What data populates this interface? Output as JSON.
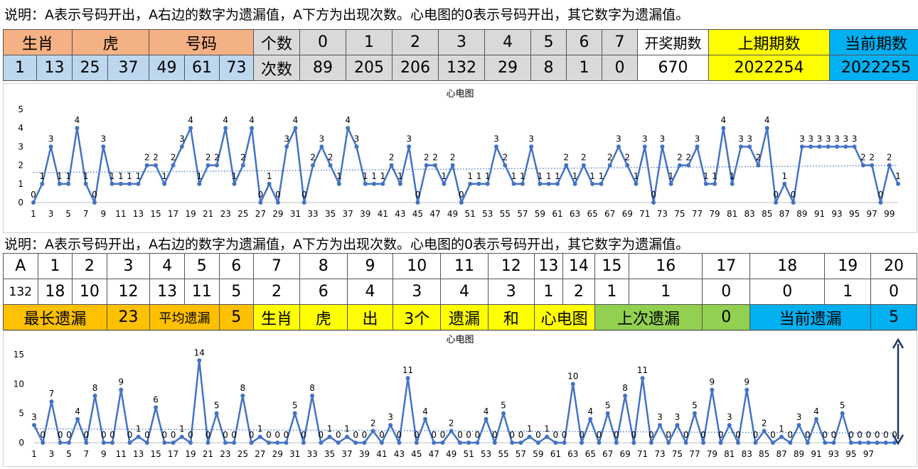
{
  "note": "说明：A表示号码开出，A右边的数字为遗漏值，A下方为出现次数。心电图的0表示号码开出，其它数字为遗漏值。",
  "table1": {
    "row1": [
      "生肖",
      "虎",
      "号码",
      "个数",
      "0",
      "1",
      "2",
      "3",
      "4",
      "5",
      "6",
      "7",
      "开奖期数",
      "上期期数",
      "当前期数"
    ],
    "row2": [
      "1",
      "13",
      "25",
      "37",
      "49",
      "61",
      "73",
      "次数",
      "89",
      "205",
      "206",
      "132",
      "29",
      "8",
      "1",
      "0",
      "670",
      "2022254",
      "2022255"
    ]
  },
  "table2": {
    "row1": [
      "A",
      "1",
      "2",
      "3",
      "4",
      "5",
      "6",
      "7",
      "8",
      "9",
      "10",
      "11",
      "12",
      "13",
      "14",
      "15",
      "16",
      "17",
      "18",
      "19",
      "20"
    ],
    "row2": [
      "132",
      "18",
      "10",
      "12",
      "13",
      "11",
      "5",
      "2",
      "6",
      "4",
      "3",
      "4",
      "3",
      "1",
      "2",
      "1",
      "1",
      "0",
      "0",
      "1",
      "0"
    ],
    "row3": [
      "最长遗漏",
      "23",
      "平均遗漏",
      "5",
      "生肖",
      "虎",
      "出",
      "3个",
      "遗漏",
      "和",
      "心电图",
      "上次遗漏",
      "0",
      "当前遗漏",
      "5"
    ]
  },
  "colors": {
    "line": "#4472c4",
    "salmon": "#f4b183",
    "blue": "#bdd7ee",
    "yellow": "#ffff00",
    "cyan": "#00b0f0",
    "orange": "#ffc000",
    "green": "#92d050",
    "arrow": "#1f3864"
  },
  "chart_data": [
    {
      "type": "line",
      "title": "心电图",
      "ylim": [
        0,
        5
      ],
      "yticks": [
        0,
        1,
        2,
        3,
        4,
        5
      ],
      "x_tick_labels": [
        "1",
        "3",
        "5",
        "7",
        "9",
        "11",
        "13",
        "15",
        "17",
        "19",
        "21",
        "23",
        "25",
        "27",
        "29",
        "31",
        "33",
        "35",
        "37",
        "39",
        "41",
        "43",
        "45",
        "47",
        "49",
        "51",
        "53",
        "55",
        "57",
        "59",
        "61",
        "63",
        "65",
        "67",
        "69",
        "71",
        "73",
        "75",
        "77",
        "79",
        "81",
        "83",
        "85",
        "87",
        "89",
        "91",
        "93",
        "95",
        "97",
        "99"
      ],
      "trendline": "linear dotted",
      "values": [
        0,
        1,
        3,
        1,
        1,
        4,
        1,
        0,
        3,
        1,
        1,
        1,
        1,
        2,
        2,
        1,
        2,
        3,
        4,
        1,
        2,
        2,
        4,
        1,
        2,
        4,
        0,
        1,
        0,
        3,
        4,
        0,
        2,
        3,
        2,
        1,
        4,
        3,
        1,
        1,
        1,
        2,
        1,
        3,
        0,
        2,
        2,
        1,
        2,
        0,
        1,
        1,
        1,
        3,
        2,
        1,
        1,
        3,
        1,
        1,
        1,
        2,
        1,
        2,
        1,
        1,
        2,
        3,
        2,
        1,
        3,
        0,
        3,
        1,
        2,
        2,
        3,
        1,
        1,
        4,
        1,
        3,
        3,
        2,
        4,
        0,
        1,
        0,
        3,
        3,
        3,
        3,
        3,
        3,
        3,
        2,
        2,
        0,
        2,
        1
      ]
    },
    {
      "type": "line",
      "title": "心电图",
      "ylim": [
        0,
        15
      ],
      "yticks": [
        0,
        5,
        10,
        15
      ],
      "x_tick_labels": [
        "1",
        "3",
        "5",
        "7",
        "9",
        "11",
        "13",
        "15",
        "17",
        "19",
        "21",
        "23",
        "25",
        "27",
        "29",
        "31",
        "33",
        "35",
        "37",
        "39",
        "41",
        "43",
        "45",
        "47",
        "49",
        "51",
        "53",
        "55",
        "57",
        "59",
        "61",
        "63",
        "65",
        "67",
        "69",
        "71",
        "73",
        "75",
        "77",
        "79",
        "81",
        "83",
        "85",
        "87",
        "89",
        "91",
        "93",
        "95",
        "97"
      ],
      "trendline": "linear dotted",
      "values": [
        3,
        0,
        7,
        0,
        0,
        4,
        0,
        8,
        0,
        0,
        9,
        0,
        1,
        0,
        6,
        0,
        0,
        1,
        0,
        14,
        0,
        5,
        0,
        0,
        8,
        0,
        1,
        0,
        0,
        0,
        5,
        0,
        8,
        0,
        1,
        0,
        1,
        0,
        0,
        2,
        0,
        3,
        0,
        11,
        0,
        4,
        0,
        0,
        2,
        0,
        0,
        0,
        4,
        0,
        5,
        0,
        0,
        1,
        0,
        1,
        0,
        0,
        10,
        0,
        4,
        0,
        5,
        0,
        8,
        0,
        11,
        0,
        3,
        0,
        3,
        0,
        5,
        0,
        9,
        0,
        3,
        0,
        9,
        0,
        2,
        0,
        1,
        0,
        3,
        0,
        4,
        0,
        0,
        5,
        0,
        0,
        0,
        0,
        0,
        0
      ]
    }
  ]
}
